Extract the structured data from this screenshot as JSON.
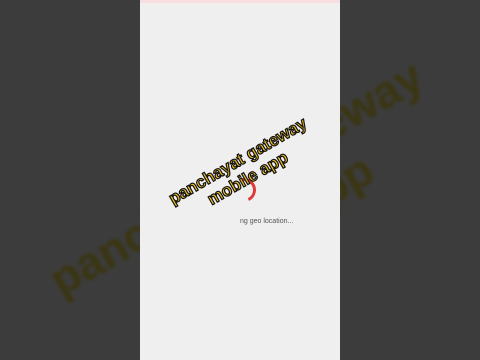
{
  "overlay": {
    "caption_line1": "panchayat gateway",
    "caption_line2": "mobile app",
    "caption_color": "#f3c323"
  },
  "screen": {
    "status_text": "ng geo location...",
    "spinner_color": "#e03a3a",
    "background": "#efefef"
  }
}
